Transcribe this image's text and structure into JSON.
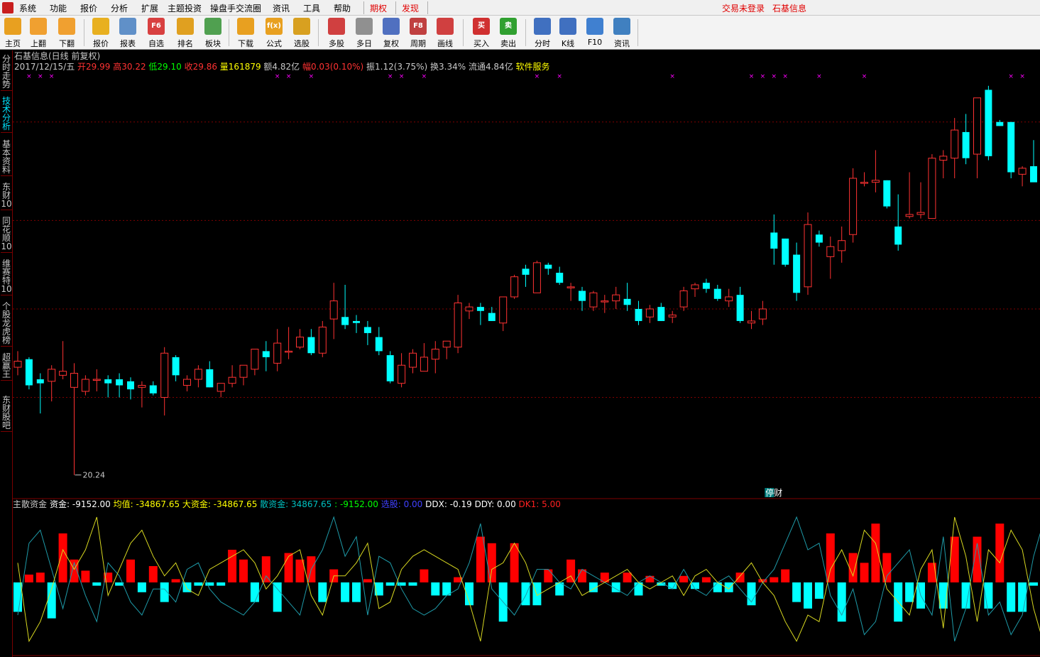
{
  "menu": {
    "items": [
      "系统",
      "功能",
      "报价",
      "分析",
      "扩展",
      "主题投资",
      "操盘手交流圈",
      "资讯",
      "工具",
      "帮助"
    ],
    "qiquan": "期权",
    "faxian": "发现",
    "login": "交易未登录",
    "stock_title": "石基信息"
  },
  "toolbar": {
    "buttons": [
      {
        "label": "主页",
        "icon": "home-icon",
        "color": "#e8a020"
      },
      {
        "label": "上翻",
        "icon": "up-arrow-icon",
        "color": "#f0a030"
      },
      {
        "label": "下翻",
        "icon": "down-arrow-icon",
        "color": "#f0a030"
      },
      {
        "label": "报价",
        "icon": "yen-icon",
        "color": "#e8b020"
      },
      {
        "label": "报表",
        "icon": "report-icon",
        "color": "#6090c8"
      },
      {
        "label": "自选",
        "icon": "f6-icon",
        "color": "#d84040",
        "text": "F6"
      },
      {
        "label": "排名",
        "icon": "ranking-icon",
        "color": "#e0a020"
      },
      {
        "label": "板块",
        "icon": "blocks-icon",
        "color": "#50a050"
      },
      {
        "label": "下载",
        "icon": "download-icon",
        "color": "#e8a020"
      },
      {
        "label": "公式",
        "icon": "formula-icon",
        "color": "#e8a020",
        "text": "f(x)"
      },
      {
        "label": "选股",
        "icon": "select-stock-icon",
        "color": "#d8a020"
      },
      {
        "label": "多股",
        "icon": "multi-stock-icon",
        "color": "#d04040"
      },
      {
        "label": "多日",
        "icon": "clock-icon",
        "color": "#909090"
      },
      {
        "label": "复权",
        "icon": "restore-icon",
        "color": "#5070c0"
      },
      {
        "label": "周期",
        "icon": "f8-icon",
        "color": "#c04040",
        "text": "F8"
      },
      {
        "label": "画线",
        "icon": "draw-line-icon",
        "color": "#d04040"
      },
      {
        "label": "买入",
        "icon": "buy-icon",
        "color": "#d03030",
        "text": "买"
      },
      {
        "label": "卖出",
        "icon": "sell-icon",
        "color": "#30a030",
        "text": "卖"
      },
      {
        "label": "分时",
        "icon": "intraday-icon",
        "color": "#4070c0"
      },
      {
        "label": "K线",
        "icon": "kline-icon",
        "color": "#4070c0"
      },
      {
        "label": "F10",
        "icon": "f10-icon",
        "color": "#4080d0"
      },
      {
        "label": "资讯",
        "icon": "news-icon",
        "color": "#4080c0"
      }
    ]
  },
  "sidebar": {
    "tabs": [
      {
        "label": "分时走势"
      },
      {
        "label": "技术分析",
        "active": true
      },
      {
        "label": "基本资料"
      },
      {
        "label": "东财10"
      },
      {
        "label": "同花顺10"
      },
      {
        "label": "维赛特10"
      },
      {
        "label": "个股龙虎榜"
      },
      {
        "label": "超赢王"
      },
      {
        "label": "东财股吧"
      }
    ]
  },
  "info": {
    "title": "石基信息(日线 前复权)",
    "date": "2017/12/15/五",
    "open_label": "开",
    "open": "29.99",
    "high_label": "高",
    "high": "30.22",
    "low_label": "低",
    "low": "29.10",
    "close_label": "收",
    "close": "29.86",
    "volume_label": "量",
    "volume": "161879",
    "amount": "额4.82亿",
    "change_label": "幅",
    "change": "0.03(0.10%)",
    "amplitude": "振1.12(3.75%)",
    "turnover": "换3.34%",
    "float": "流通4.84亿",
    "industry": "软件服务"
  },
  "chart_data": [
    {
      "type": "candlestick",
      "title": "石基信息(日线 前复权)",
      "min_label": "20.24",
      "event_label": "停财",
      "series": [
        {
          "name": "K",
          "ohlc": [
            [
              25.6,
              26.4,
              25.2,
              25.9
            ],
            [
              26.0,
              26.1,
              24.5,
              24.7
            ],
            [
              25.0,
              25.3,
              23.3,
              24.8
            ],
            [
              24.9,
              25.7,
              23.9,
              25.5
            ],
            [
              25.2,
              26.9,
              25.0,
              25.4
            ],
            [
              24.6,
              25.8,
              20.24,
              25.3
            ],
            [
              24.4,
              25.2,
              24.2,
              25.0
            ],
            [
              25.0,
              25.5,
              24.4,
              25.0
            ],
            [
              25.0,
              25.2,
              24.1,
              24.8
            ],
            [
              25.0,
              25.3,
              24.1,
              24.7
            ],
            [
              24.9,
              25.1,
              24.0,
              24.5
            ],
            [
              24.6,
              24.9,
              23.6,
              24.7
            ],
            [
              24.7,
              24.9,
              24.2,
              24.3
            ],
            [
              24.1,
              26.6,
              23.2,
              26.3
            ],
            [
              26.1,
              26.2,
              24.9,
              25.2
            ],
            [
              24.7,
              25.2,
              24.4,
              25.0
            ],
            [
              25.0,
              25.7,
              24.6,
              25.5
            ],
            [
              25.5,
              25.9,
              24.6,
              24.6
            ],
            [
              24.4,
              24.8,
              24.1,
              24.8
            ],
            [
              24.8,
              25.7,
              24.6,
              25.1
            ],
            [
              25.1,
              25.5,
              24.7,
              25.7
            ],
            [
              25.5,
              26.5,
              25.2,
              26.5
            ],
            [
              26.4,
              26.9,
              25.4,
              26.1
            ],
            [
              25.8,
              27.5,
              25.4,
              26.8
            ],
            [
              26.4,
              27.6,
              26.0,
              26.4
            ],
            [
              26.6,
              27.5,
              26.5,
              27.1
            ],
            [
              27.1,
              27.5,
              26.2,
              26.3
            ],
            [
              26.3,
              27.9,
              26.1,
              27.6
            ],
            [
              28.0,
              29.8,
              27.0,
              28.9
            ],
            [
              28.1,
              29.7,
              27.5,
              27.7
            ],
            [
              27.9,
              28.2,
              27.3,
              27.8
            ],
            [
              27.6,
              27.9,
              26.7,
              27.3
            ],
            [
              27.1,
              27.6,
              26.2,
              26.4
            ],
            [
              26.2,
              26.4,
              24.8,
              24.9
            ],
            [
              24.8,
              26.3,
              24.6,
              25.7
            ],
            [
              25.6,
              26.5,
              25.3,
              26.3
            ],
            [
              25.4,
              26.8,
              25.4,
              26.1
            ],
            [
              26.0,
              26.9,
              25.3,
              26.5
            ],
            [
              26.6,
              26.9,
              26.0,
              26.9
            ],
            [
              26.6,
              29.2,
              26.3,
              28.8
            ],
            [
              28.4,
              28.8,
              28.0,
              28.6
            ],
            [
              28.6,
              28.8,
              27.7,
              28.4
            ],
            [
              28.3,
              28.6,
              27.9,
              27.9
            ],
            [
              27.8,
              29.1,
              27.4,
              29.1
            ],
            [
              29.1,
              30.2,
              29.0,
              30.1
            ],
            [
              30.5,
              30.7,
              29.6,
              30.2
            ],
            [
              29.3,
              30.9,
              29.3,
              30.8
            ],
            [
              30.7,
              30.8,
              30.2,
              30.5
            ],
            [
              30.3,
              30.6,
              29.7,
              29.8
            ],
            [
              29.6,
              29.8,
              28.9,
              29.6
            ],
            [
              29.4,
              29.6,
              28.4,
              28.9
            ],
            [
              28.6,
              29.4,
              28.4,
              29.3
            ],
            [
              28.9,
              29.2,
              28.3,
              28.9
            ],
            [
              28.9,
              29.6,
              28.5,
              29.2
            ],
            [
              29.0,
              29.8,
              28.4,
              28.7
            ],
            [
              28.5,
              28.9,
              27.7,
              27.9
            ],
            [
              28.1,
              28.7,
              27.8,
              28.5
            ],
            [
              28.6,
              28.8,
              27.9,
              27.9
            ],
            [
              28.1,
              28.4,
              27.8,
              28.2
            ],
            [
              28.6,
              29.6,
              28.4,
              29.4
            ],
            [
              29.5,
              29.8,
              29.1,
              29.7
            ],
            [
              29.8,
              30.0,
              29.3,
              29.5
            ],
            [
              29.5,
              29.7,
              28.9,
              29.0
            ],
            [
              28.9,
              29.5,
              28.6,
              29.1
            ],
            [
              29.2,
              29.6,
              27.8,
              27.9
            ],
            [
              27.8,
              28.4,
              27.5,
              27.9
            ],
            [
              28.0,
              28.9,
              27.7,
              28.5
            ],
            [
              32.3,
              33.2,
              30.7,
              31.5
            ],
            [
              32.0,
              32.0,
              30.6,
              30.7
            ],
            [
              31.2,
              31.8,
              28.9,
              29.3
            ],
            [
              29.6,
              33.3,
              29.2,
              32.7
            ],
            [
              32.2,
              32.4,
              31.6,
              31.8
            ],
            [
              31.1,
              32.1,
              30.0,
              31.6
            ],
            [
              31.4,
              32.6,
              30.8,
              31.9
            ],
            [
              32.2,
              35.5,
              31.8,
              35.0
            ],
            [
              34.8,
              35.3,
              34.6,
              34.8
            ],
            [
              34.8,
              36.4,
              34.3,
              34.9
            ],
            [
              34.9,
              34.9,
              33.5,
              33.6
            ],
            [
              32.6,
              34.2,
              31.4,
              31.7
            ],
            [
              33.1,
              35.3,
              33.0,
              33.2
            ],
            [
              33.2,
              34.8,
              33.0,
              33.3
            ],
            [
              33.0,
              36.2,
              33.0,
              36.0
            ],
            [
              35.9,
              36.4,
              35.0,
              36.1
            ],
            [
              36.0,
              38.0,
              35.0,
              37.4
            ],
            [
              37.3,
              38.2,
              35.7,
              36.0
            ],
            [
              36.2,
              38.6,
              35.0,
              39.0
            ],
            [
              39.4,
              39.6,
              35.9,
              36.1
            ],
            [
              37.8,
              37.9,
              37.6,
              37.6
            ],
            [
              37.8,
              37.8,
              35.0,
              35.3
            ],
            [
              35.2,
              35.6,
              34.6,
              35.5
            ],
            [
              35.6,
              36.9,
              34.9,
              34.8
            ],
            [
              33.3,
              33.5,
              31.3,
              32.3
            ]
          ]
        }
      ],
      "ylim": [
        19.1,
        40.3
      ],
      "gridlines": [
        24.1,
        28.5,
        32.9,
        37.8
      ],
      "markers_days": [
        1,
        2,
        3,
        23,
        24,
        26,
        33,
        34,
        36,
        46,
        48,
        58,
        65,
        66,
        67,
        68,
        71,
        75,
        88,
        89
      ]
    },
    {
      "type": "bar+line",
      "title": "主散资金",
      "legend": [
        {
          "label": "资金: -9152.00",
          "color": "#ffffff"
        },
        {
          "label": "均值: -34867.65",
          "color": "#ffff00"
        },
        {
          "label": "大资金: -34867.65",
          "color": "#ffff00"
        },
        {
          "label": "散资金: 34867.65",
          "color": "#00c0c0"
        },
        {
          "label": ": -9152.00",
          "color": "#00ff00"
        },
        {
          "label": "选股: 0.00",
          "color": "#4040ff"
        },
        {
          "label": "DDX: -0.19",
          "color": "#ffffff"
        },
        {
          "label": "DDY: 0.00",
          "color": "#ffffff"
        },
        {
          "label": "DK1: 5.00",
          "color": "#ff2020"
        }
      ],
      "bars": [
        -0.45,
        0.12,
        0.15,
        -0.55,
        0.75,
        0.35,
        0.18,
        -0.05,
        0.15,
        -0.05,
        0.35,
        -0.15,
        0.25,
        -0.3,
        0.05,
        -0.15,
        -0.05,
        -0.05,
        -0.05,
        0.5,
        0.35,
        -0.3,
        0.4,
        -0.45,
        0.45,
        0.35,
        0.4,
        -0.3,
        0.2,
        -0.3,
        -0.3,
        0.05,
        -0.2,
        -0.05,
        -0.05,
        -0.05,
        0.2,
        -0.2,
        -0.2,
        0.08,
        -0.35,
        0.7,
        0.6,
        -0.6,
        0.6,
        -0.35,
        -0.35,
        0.2,
        -0.2,
        0.35,
        0.2,
        -0.15,
        0.15,
        -0.15,
        0.15,
        -0.2,
        0.1,
        -0.05,
        -0.1,
        0.1,
        -0.1,
        0.08,
        -0.15,
        -0.15,
        0.15,
        -0.35,
        0.05,
        0.08,
        0.2,
        -0.3,
        -0.4,
        -0.25,
        0.75,
        -0.6,
        0.45,
        0.3,
        0.9,
        0.45,
        -0.6,
        -0.3,
        -0.4,
        0.3,
        -0.4,
        0.7,
        -0.4,
        0.7,
        -0.4,
        0.9,
        -0.45,
        -0.45,
        -0.05,
        -0.6
      ],
      "line_yellow": [
        0.3,
        -0.9,
        -0.6,
        -0.1,
        0.5,
        0.2,
        0.5,
        1.0,
        -0.2,
        0.2,
        0.6,
        0.8,
        0.4,
        0.1,
        0.3,
        -0.1,
        -0.2,
        0.2,
        0.3,
        0.4,
        0.5,
        0.3,
        -0.1,
        0.1,
        0.4,
        0.5,
        -0.2,
        -0.5,
        0.1,
        0.1,
        0.3,
        0.6,
        -0.4,
        -0.3,
        0.2,
        0.4,
        0.5,
        0.4,
        0.3,
        0.2,
        -0.3,
        -0.9,
        0.2,
        0.3,
        0.6,
        0.3,
        -0.2,
        -0.1,
        0.0,
        0.1,
        -0.2,
        -0.1,
        0.0,
        0.1,
        0.2,
        0.0,
        -0.1,
        0.0,
        0.1,
        -0.2,
        0.1,
        0.2,
        0.0,
        -0.1,
        0.1,
        0.3,
        0.0,
        -0.2,
        -0.6,
        -0.9,
        -0.5,
        -0.6,
        0.2,
        0.5,
        0.1,
        0.8,
        0.6,
        -0.1,
        -0.3,
        -0.5,
        0.2,
        0.5,
        -0.7,
        1.0,
        0.4,
        -0.6,
        0.5,
        0.3,
        0.8,
        0.5,
        -0.4,
        -1.0
      ],
      "line_cyan": [
        -0.5,
        0.6,
        0.8,
        0.2,
        -0.4,
        0.3,
        -0.2,
        -0.6,
        0.3,
        0.1,
        -0.3,
        -0.5,
        -0.1,
        -0.1,
        -0.3,
        0.2,
        0.3,
        -0.1,
        -0.3,
        -0.4,
        -0.5,
        -0.3,
        0.1,
        -0.1,
        -0.3,
        -0.5,
        0.2,
        0.5,
        1.0,
        0.4,
        0.7,
        -0.5,
        0.4,
        0.3,
        -0.1,
        -0.4,
        -0.5,
        -0.4,
        -0.2,
        -0.1,
        0.3,
        0.9,
        -0.1,
        -0.3,
        -0.5,
        -0.2,
        0.2,
        0.2,
        0.0,
        -0.1,
        0.2,
        0.1,
        0.0,
        -0.1,
        -0.2,
        0.0,
        0.1,
        0.0,
        -0.1,
        0.2,
        -0.1,
        -0.2,
        0.0,
        0.1,
        -0.1,
        -0.3,
        0.0,
        0.2,
        0.6,
        1.0,
        0.5,
        0.6,
        -0.2,
        -0.5,
        -0.1,
        -0.8,
        -0.6,
        0.1,
        0.3,
        0.5,
        -0.2,
        -0.5,
        0.7,
        -0.9,
        -0.4,
        0.6,
        -0.5,
        -0.3,
        -0.8,
        -0.5,
        0.4,
        1.0
      ]
    }
  ],
  "colors": {
    "up": "#ff3232",
    "down": "#00ffff",
    "grid": "#800000",
    "marker": "#ff00ff"
  }
}
